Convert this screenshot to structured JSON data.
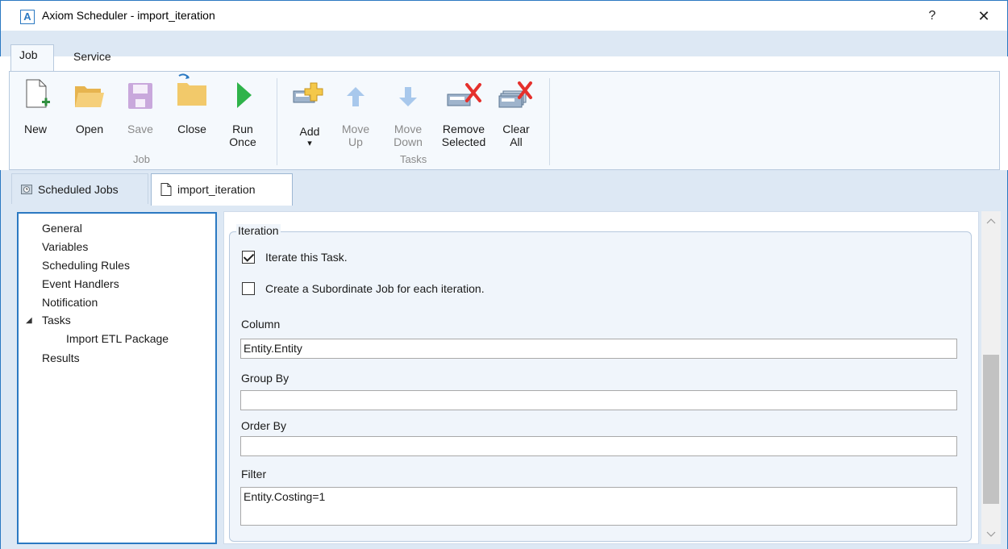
{
  "window": {
    "app_icon_letter": "A",
    "title": "Axiom Scheduler - import_iteration",
    "help_label": "?",
    "close_label": "✕"
  },
  "ribbon": {
    "tabs": [
      {
        "label": "Job",
        "selected": true
      },
      {
        "label": "Service",
        "selected": false
      }
    ],
    "groups": {
      "job": {
        "label": "Job",
        "buttons": [
          {
            "label": "New",
            "icon": "new-file-icon",
            "enabled": true
          },
          {
            "label": "Open",
            "icon": "open-folder-icon",
            "enabled": true
          },
          {
            "label": "Save",
            "icon": "save-icon",
            "enabled": false
          },
          {
            "label": "Close",
            "icon": "close-folder-icon",
            "enabled": true
          },
          {
            "label_line1": "Run",
            "label_line2": "Once",
            "icon": "run-icon",
            "enabled": true
          }
        ]
      },
      "tasks": {
        "label": "Tasks",
        "buttons": [
          {
            "label": "Add",
            "dropdown": "▾",
            "icon": "add-task-icon",
            "enabled": true
          },
          {
            "label_line1": "Move",
            "label_line2": "Up",
            "icon": "arrow-up-icon",
            "enabled": false
          },
          {
            "label_line1": "Move",
            "label_line2": "Down",
            "icon": "arrow-down-icon",
            "enabled": false
          },
          {
            "label_line1": "Remove",
            "label_line2": "Selected",
            "icon": "remove-task-icon",
            "enabled": true
          },
          {
            "label_line1": "Clear",
            "label_line2": "All",
            "icon": "clear-all-icon",
            "enabled": true
          }
        ]
      }
    }
  },
  "doc_tabs": [
    {
      "label": "Scheduled Jobs",
      "icon": "scheduled-jobs-icon",
      "active": false
    },
    {
      "label": "import_iteration",
      "icon": "document-icon",
      "active": true
    }
  ],
  "tree": {
    "items": [
      {
        "label": "General"
      },
      {
        "label": "Variables"
      },
      {
        "label": "Scheduling Rules"
      },
      {
        "label": "Event Handlers"
      },
      {
        "label": "Notification"
      },
      {
        "label": "Tasks",
        "expander": "◢"
      },
      {
        "label": "Import ETL Package"
      },
      {
        "label": "Results"
      }
    ]
  },
  "iteration": {
    "group_title": "Iteration",
    "iterate_checkbox": {
      "label": "Iterate this Task.",
      "checked": true
    },
    "subordinate_checkbox": {
      "label": "Create a Subordinate Job for each iteration.",
      "checked": false
    },
    "column": {
      "label": "Column",
      "value": "Entity.Entity"
    },
    "group_by": {
      "label": "Group By",
      "value": ""
    },
    "order_by": {
      "label": "Order By",
      "value": ""
    },
    "filter": {
      "label": "Filter",
      "value": "Entity.Costing=1"
    }
  },
  "colors": {
    "accent": "#2b79c2",
    "ribbon_bg": "#dde8f4",
    "run_green": "#2fb34a",
    "remove_red": "#e5302c",
    "folder_yellow": "#f2c96a"
  }
}
